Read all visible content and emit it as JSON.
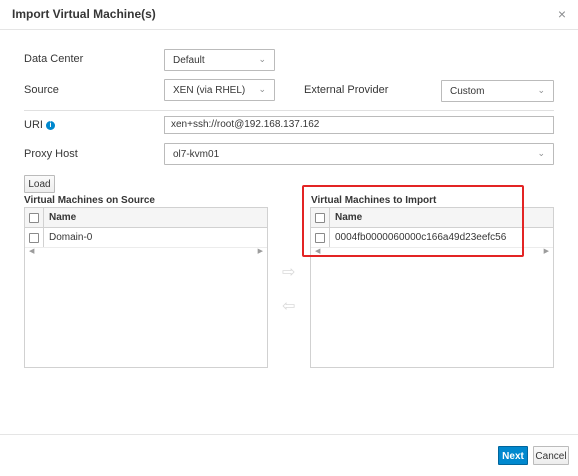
{
  "dialog": {
    "title": "Import Virtual Machine(s)",
    "close_glyph": "×"
  },
  "form": {
    "data_center_label": "Data Center",
    "data_center_value": "Default",
    "source_label": "Source",
    "source_value": "XEN (via RHEL)",
    "external_provider_label": "External Provider",
    "external_provider_value": "Custom",
    "uri_label": "URI",
    "uri_value": "xen+ssh://root@192.168.137.162",
    "proxy_host_label": "Proxy Host",
    "proxy_host_value": "ol7-kvm01",
    "load_label": "Load"
  },
  "source_list": {
    "title": "Virtual Machines on Source",
    "header": "Name",
    "rows": [
      "Domain-0"
    ]
  },
  "import_list": {
    "title": "Virtual Machines to Import",
    "header": "Name",
    "rows": [
      "0004fb0000060000c166a49d23eefc56"
    ]
  },
  "footer": {
    "next_label": "Next",
    "cancel_label": "Cancel"
  },
  "icons": {
    "info": "i",
    "chevron": "⌄",
    "scroll_left": "◀",
    "scroll_right": "▶",
    "move_right": "⇨",
    "move_left": "⇦"
  },
  "colors": {
    "primary": "#0088ce",
    "highlight": "#e32424"
  }
}
